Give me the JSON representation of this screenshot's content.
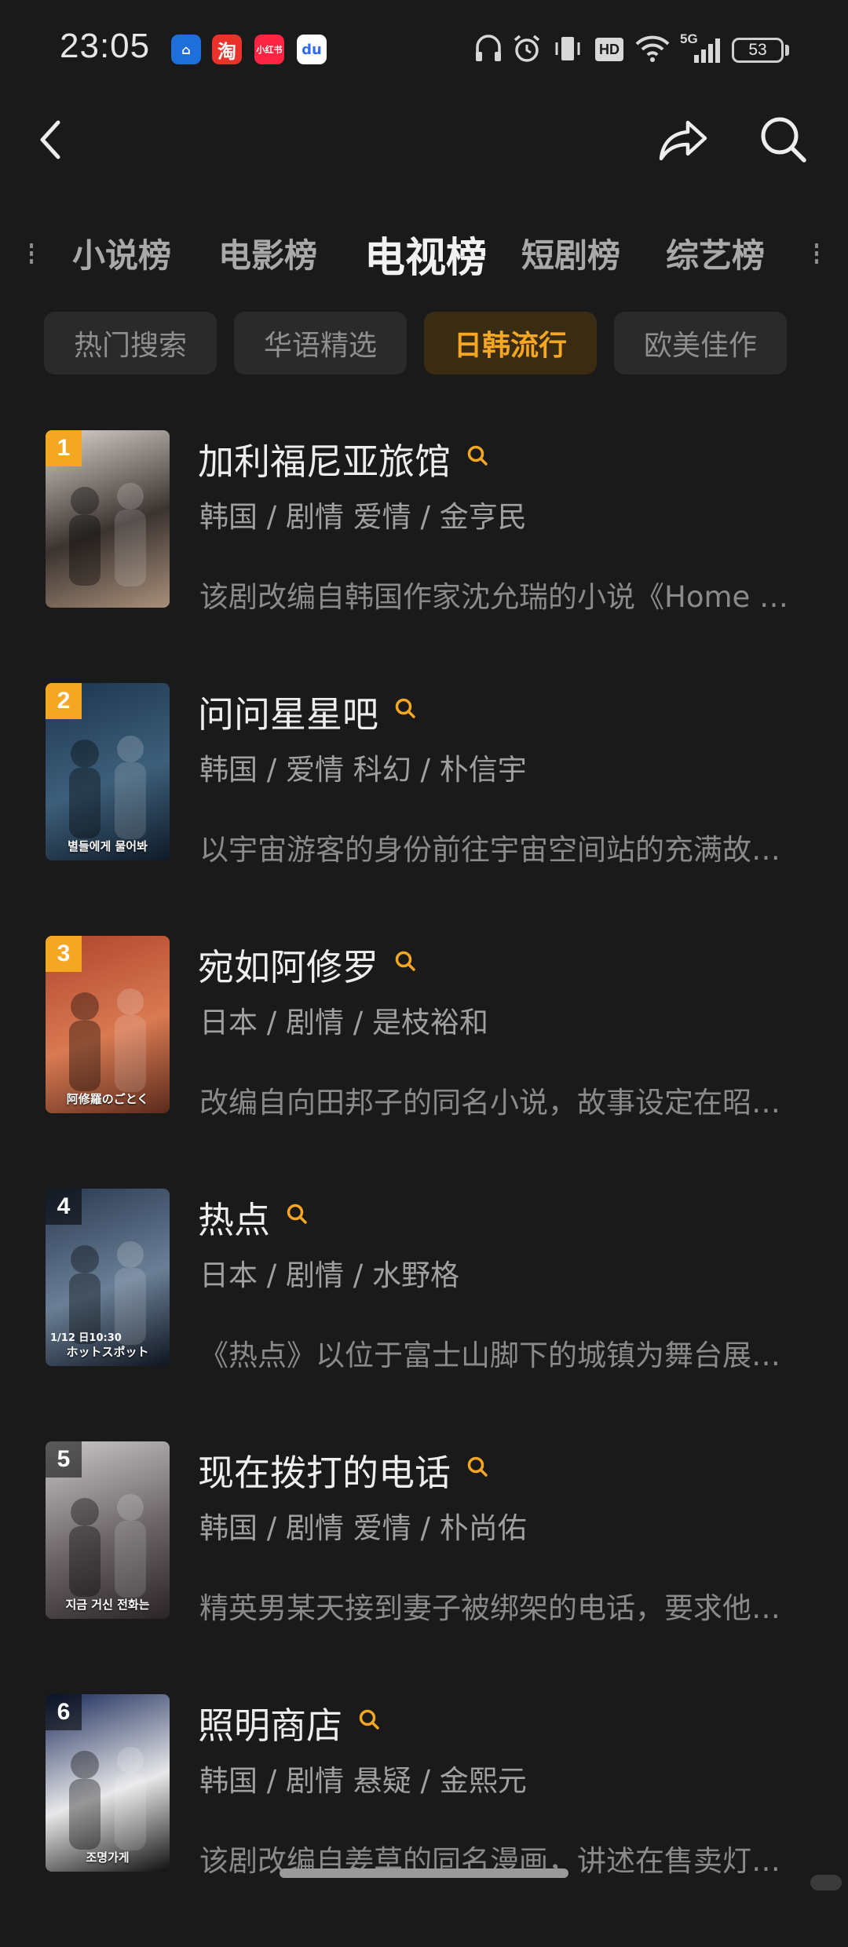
{
  "status_bar": {
    "time": "23:05",
    "apps": [
      {
        "name": "weather-app-icon",
        "label": "⌂",
        "color": "#1e6fd9"
      },
      {
        "name": "taobao-app-icon",
        "label": "淘",
        "color": "#e8322a"
      },
      {
        "name": "xiaohongshu-app-icon",
        "label": "小红书",
        "color": "#ff2442"
      },
      {
        "name": "baidu-app-icon",
        "label": "du",
        "color": "#2f6bf2"
      }
    ],
    "network": "5G",
    "hd_label": "HD",
    "battery": "53"
  },
  "nav": {
    "back_icon": "back-arrow-icon",
    "share_icon": "share-icon",
    "search_icon": "search-icon"
  },
  "category_tabs": [
    "小说榜",
    "电影榜",
    "电视榜",
    "短剧榜",
    "综艺榜"
  ],
  "active_category": "电视榜",
  "filter_chips": [
    "热门搜索",
    "华语精选",
    "日韩流行",
    "欧美佳作"
  ],
  "active_chip": "日韩流行",
  "items": [
    {
      "rank": "1",
      "title": "加利福尼亚旅馆",
      "meta": "韩国 / 剧情 爱情 / 金亨民",
      "desc": "该剧改编自韩国作家沈允瑞的小说《Home Sweet Home》",
      "poster_colors": [
        "#d9d4cc",
        "#3b3330",
        "#a88f7a"
      ]
    },
    {
      "rank": "2",
      "title": "问问星星吧",
      "meta": "韩国 / 爱情 科幻 / 朴信宇",
      "desc": "以宇宙游客的身份前往宇宙空间站的充满故事的爱情",
      "poster_colors": [
        "#1d3550",
        "#3d5f7a",
        "#0f1a28"
      ],
      "poster_text": "별들에게 물어봐"
    },
    {
      "rank": "3",
      "title": "宛如阿修罗",
      "meta": "日本 / 剧情 / 是枝裕和",
      "desc": "改编自向田邦子的同名小说，故事设定在昭和时代",
      "poster_colors": [
        "#b0452e",
        "#d97a52",
        "#5a2a1c"
      ],
      "poster_text": "阿修羅のごとく"
    },
    {
      "rank": "4",
      "title": "热点",
      "meta": "日本 / 剧情 / 水野格",
      "desc": "《热点》以位于富士山脚下的城镇为舞台展开故事",
      "poster_colors": [
        "#2b3a52",
        "#6a7f96",
        "#0f1520"
      ],
      "poster_text": "ホットスポット",
      "poster_date": "1/12 日10:30"
    },
    {
      "rank": "5",
      "title": "现在拨打的电话",
      "meta": "韩国 / 剧情 爱情 / 朴尚佑",
      "desc": "精英男某天接到妻子被绑架的电话，要求他交出赎金",
      "poster_colors": [
        "#c9c7c8",
        "#6b6466",
        "#2a2426"
      ],
      "poster_text": "지금 거신 전화는"
    },
    {
      "rank": "6",
      "title": "照明商店",
      "meta": "韩国 / 剧情 悬疑 / 金熙元",
      "desc": "该剧改编自姜草的同名漫画，讲述在售卖灯具的商店里",
      "poster_colors": [
        "#1a2a5a",
        "#e8e8ea",
        "#101010"
      ],
      "poster_text": "조명가게"
    }
  ]
}
